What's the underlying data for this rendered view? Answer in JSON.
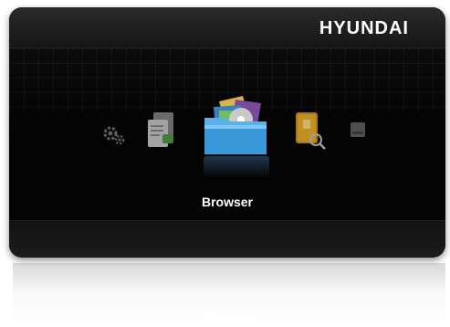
{
  "header": {
    "brand": "HYUNDAI"
  },
  "menu": {
    "items": [
      {
        "id": "settings",
        "icon": "gear-icon"
      },
      {
        "id": "documents",
        "icon": "document-icon"
      },
      {
        "id": "browser",
        "icon": "folder-media-icon",
        "selected": true
      },
      {
        "id": "usb",
        "icon": "usb-drive-icon"
      },
      {
        "id": "storage",
        "icon": "storage-icon"
      }
    ],
    "selected_label": "Browser"
  },
  "colors": {
    "screen": "#050505",
    "accent": "#3a9ad9",
    "text": "#ffffff"
  }
}
